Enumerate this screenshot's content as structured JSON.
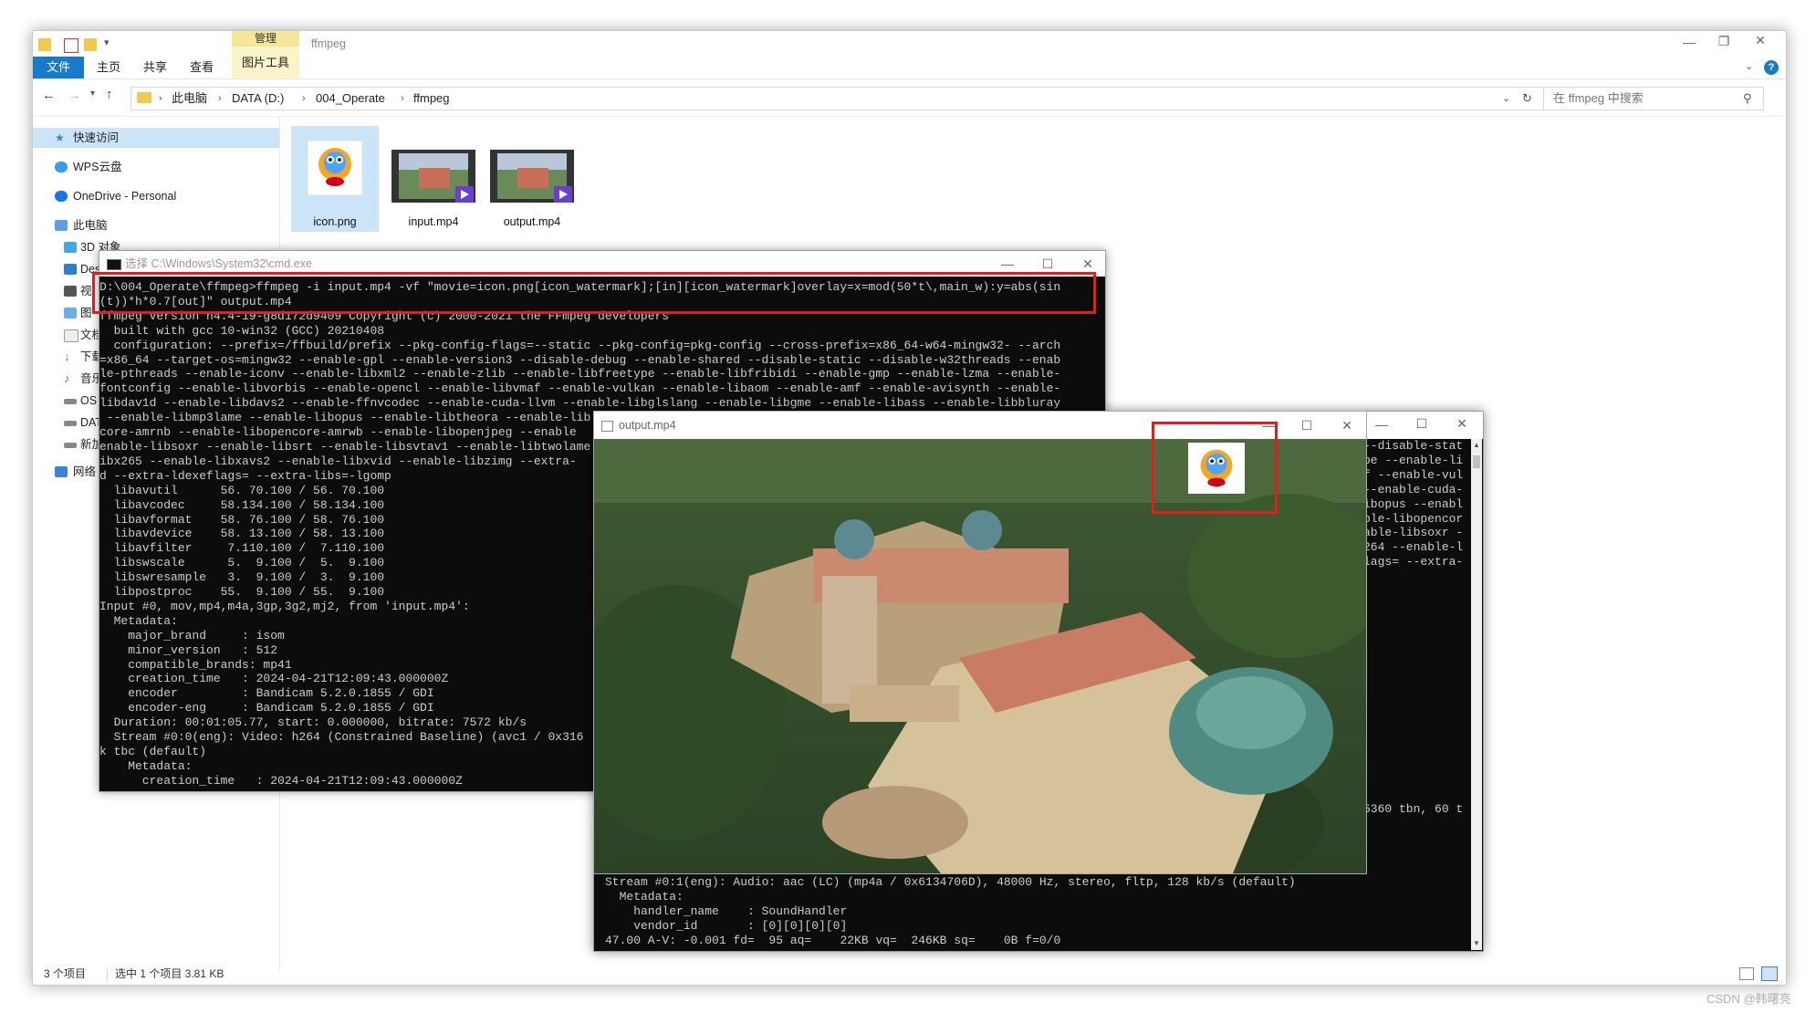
{
  "explorer": {
    "title": "ffmpeg",
    "contextual_group": "管理",
    "contextual_tab": "图片工具",
    "ribbon_tabs": [
      "文件",
      "主页",
      "共享",
      "查看"
    ],
    "breadcrumb": [
      "此电脑",
      "DATA (D:)",
      "004_Operate",
      "ffmpeg"
    ],
    "search_placeholder": "在 ffmpeg 中搜索",
    "nav": {
      "quick_access": "快速访问",
      "wps": "WPS云盘",
      "onedrive": "OneDrive - Personal",
      "this_pc": "此电脑",
      "children": [
        "3D 对象",
        "Des",
        "视",
        "图",
        "文档",
        "下载",
        "音乐",
        "OS",
        "DAT",
        "新加"
      ],
      "network": "网络"
    },
    "files": [
      {
        "name": "icon.png",
        "type": "image",
        "selected": true
      },
      {
        "name": "input.mp4",
        "type": "video",
        "selected": false
      },
      {
        "name": "output.mp4",
        "type": "video",
        "selected": false
      }
    ],
    "status": {
      "count": "3 个项目",
      "selected": "选中 1 个项目  3.81 KB"
    }
  },
  "cmd": {
    "title": "选择 C:\\Windows\\System32\\cmd.exe",
    "lines": [
      "D:\\004_Operate\\ffmpeg>ffmpeg -i input.mp4 -vf \"movie=icon.png[icon_watermark];[in][icon_watermark]overlay=x=mod(50*t\\,main_w):y=abs(sin",
      "(t))*h*0.7[out]\" output.mp4",
      "ffmpeg version n4.4-19-g8d172d9409 Copyright (c) 2000-2021 the FFmpeg developers",
      "  built with gcc 10-win32 (GCC) 20210408",
      "  configuration: --prefix=/ffbuild/prefix --pkg-config-flags=--static --pkg-config=pkg-config --cross-prefix=x86_64-w64-mingw32- --arch",
      "=x86_64 --target-os=mingw32 --enable-gpl --enable-version3 --disable-debug --enable-shared --disable-static --disable-w32threads --enab",
      "le-pthreads --enable-iconv --enable-libxml2 --enable-zlib --enable-libfreetype --enable-libfribidi --enable-gmp --enable-lzma --enable-",
      "fontconfig --enable-libvorbis --enable-opencl --enable-libvmaf --enable-vulkan --enable-libaom --enable-amf --enable-avisynth --enable-",
      "libdav1d --enable-libdavs2 --enable-ffnvcodec --enable-cuda-llvm --enable-libglslang --enable-libgme --enable-libass --enable-libbluray",
      " --enable-libmp3lame --enable-libopus --enable-libtheora --enable-lib",
      "core-amrnb --enable-libopencore-amrwb --enable-libopenjpeg --enable",
      "enable-libsoxr --enable-libsrt --enable-libsvtav1 --enable-libtwolame",
      "ibx265 --enable-libxavs2 --enable-libxvid --enable-libzimg --extra-",
      "d --extra-ldexeflags= --extra-libs=-lgomp",
      "  libavutil      56. 70.100 / 56. 70.100",
      "  libavcodec     58.134.100 / 58.134.100",
      "  libavformat    58. 76.100 / 58. 76.100",
      "  libavdevice    58. 13.100 / 58. 13.100",
      "  libavfilter     7.110.100 /  7.110.100",
      "  libswscale      5.  9.100 /  5.  9.100",
      "  libswresample   3.  9.100 /  3.  9.100",
      "  libpostproc    55.  9.100 / 55.  9.100",
      "Input #0, mov,mp4,m4a,3gp,3g2,mj2, from 'input.mp4':",
      "  Metadata:",
      "    major_brand     : isom",
      "    minor_version   : 512",
      "    compatible_brands: mp41",
      "    creation_time   : 2024-04-21T12:09:43.000000Z",
      "    encoder         : Bandicam 5.2.0.1855 / GDI",
      "    encoder-eng     : Bandicam 5.2.0.1855 / GDI",
      "  Duration: 00:01:05.77, start: 0.000000, bitrate: 7572 kb/s",
      "  Stream #0:0(eng): Video: h264 (Constrained Baseline) (avc1 / 0x316",
      "k tbc (default)",
      "    Metadata:",
      "      creation_time   : 2024-04-21T12:09:43.000000Z"
    ]
  },
  "cmd2": {
    "right_lines": [
      "--disable-stat",
      "pe --enable-li",
      "f --enable-vul",
      "--enable-cuda-",
      "ibopus --enabl",
      "ble-libopencor",
      "able-libsoxr -",
      "264 --enable-l",
      "lags= --extra-"
    ],
    "right_tail": "5360 tbn, 60 t",
    "bottom_lines": [
      "Stream #0:1(eng): Audio: aac (LC) (mp4a / 0x6134706D), 48000 Hz, stereo, fltp, 128 kb/s (default)",
      "  Metadata:",
      "    handler_name    : SoundHandler",
      "    vendor_id       : [0][0][0][0]",
      "47.00 A-V: -0.001 fd=  95 aq=    22KB vq=  246KB sq=    0B f=0/0"
    ]
  },
  "player": {
    "title": "output.mp4"
  },
  "watermark": "CSDN @韩曙亮"
}
